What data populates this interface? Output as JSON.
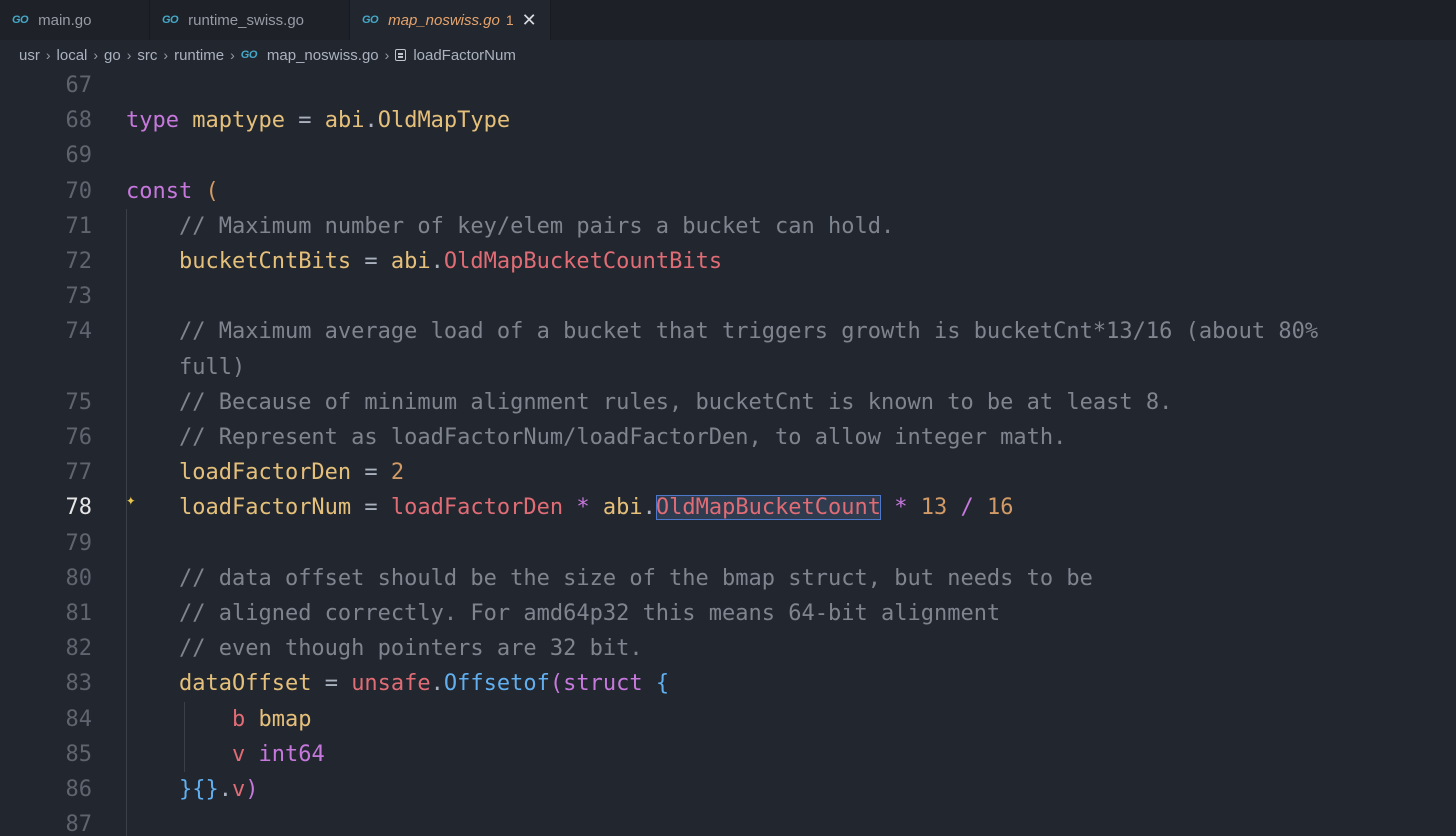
{
  "tabs": [
    {
      "label": "main.go",
      "icon": "go-file-icon"
    },
    {
      "label": "runtime_swiss.go",
      "icon": "go-file-icon"
    },
    {
      "label": "map_noswiss.go",
      "icon": "go-file-icon",
      "badge": "1",
      "active": true
    }
  ],
  "go_icon_glyph": "GO",
  "close_glyph": "✕",
  "breadcrumb": [
    "usr",
    "local",
    "go",
    "src",
    "runtime",
    "map_noswiss.go",
    "loadFactorNum"
  ],
  "breadcrumb_sep": "›",
  "current_line": 78,
  "selected_token": "OldMapBucketCount",
  "sparkle_glyph": "✦",
  "colors": {
    "background": "#22262e",
    "keyword": "#c678dd",
    "comment": "#7f848e",
    "identifier": "#e5c07b",
    "field": "#e06c75",
    "number": "#d19a66",
    "function": "#61afef",
    "active_tab_text": "#e5a36c"
  },
  "lines": [
    {
      "n": "67",
      "text": ""
    },
    {
      "n": "68",
      "text": "type maptype = abi.OldMapType"
    },
    {
      "n": "69",
      "text": ""
    },
    {
      "n": "70",
      "text": "const ("
    },
    {
      "n": "71",
      "text": "    // Maximum number of key/elem pairs a bucket can hold."
    },
    {
      "n": "72",
      "text": "    bucketCntBits = abi.OldMapBucketCountBits"
    },
    {
      "n": "73",
      "text": ""
    },
    {
      "n": "74",
      "text": "    // Maximum average load of a bucket that triggers growth is bucketCnt*13/16 (about 80%"
    },
    {
      "n": "",
      "text": "    full)"
    },
    {
      "n": "75",
      "text": "    // Because of minimum alignment rules, bucketCnt is known to be at least 8."
    },
    {
      "n": "76",
      "text": "    // Represent as loadFactorNum/loadFactorDen, to allow integer math."
    },
    {
      "n": "77",
      "text": "    loadFactorDen = 2"
    },
    {
      "n": "78",
      "text": "    loadFactorNum = loadFactorDen * abi.OldMapBucketCount * 13 / 16"
    },
    {
      "n": "79",
      "text": ""
    },
    {
      "n": "80",
      "text": "    // data offset should be the size of the bmap struct, but needs to be"
    },
    {
      "n": "81",
      "text": "    // aligned correctly. For amd64p32 this means 64-bit alignment"
    },
    {
      "n": "82",
      "text": "    // even though pointers are 32 bit."
    },
    {
      "n": "83",
      "text": "    dataOffset = unsafe.Offsetof(struct {"
    },
    {
      "n": "84",
      "text": "        b bmap"
    },
    {
      "n": "85",
      "text": "        v int64"
    },
    {
      "n": "86",
      "text": "    }{}.v)"
    },
    {
      "n": "87",
      "text": ""
    }
  ]
}
